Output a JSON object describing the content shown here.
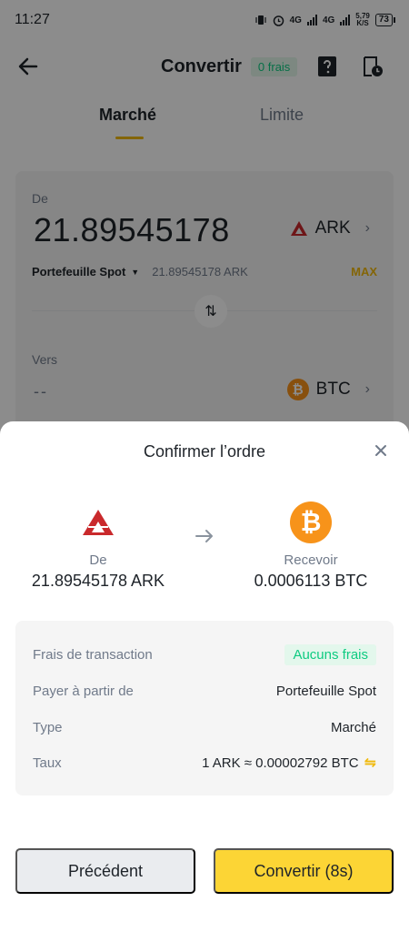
{
  "status_bar": {
    "time": "11:27",
    "net1": "4G",
    "net2": "4G",
    "speed_value": "5,79",
    "speed_unit": "K/S",
    "battery": "73"
  },
  "header": {
    "title": "Convertir",
    "fee_badge": "0 frais",
    "icons": [
      "back-arrow-icon",
      "help-icon",
      "history-icon"
    ]
  },
  "tabs": [
    {
      "label": "Marché",
      "active": true
    },
    {
      "label": "Limite",
      "active": false
    }
  ],
  "convert": {
    "from_label": "De",
    "from_amount": "21.89545178",
    "from_asset": "ARK",
    "wallet_name": "Portefeuille Spot",
    "wallet_balance": "21.89545178 ARK",
    "max_label": "MAX",
    "to_label": "Vers",
    "to_amount": "--",
    "to_asset": "BTC"
  },
  "modal": {
    "title": "Confirmer l’ordre",
    "from_label": "De",
    "from_amount": "21.89545178 ARK",
    "to_label": "Recevoir",
    "to_amount": "0.0006113 BTC",
    "details": [
      {
        "label": "Frais de transaction",
        "value": "Aucuns frais"
      },
      {
        "label": "Payer à partir de",
        "value": "Portefeuille Spot"
      },
      {
        "label": "Type",
        "value": "Marché"
      },
      {
        "label": "Taux",
        "value": "1 ARK ≈ 0.00002792 BTC"
      }
    ],
    "prev_button": "Précédent",
    "convert_button": "Convertir (8s)"
  },
  "colors": {
    "brand_yellow": "#fcd535",
    "accent_yellow": "#f0b90b",
    "green": "#0ecb81",
    "ark_red": "#c9292c",
    "btc_orange": "#f7931a"
  }
}
